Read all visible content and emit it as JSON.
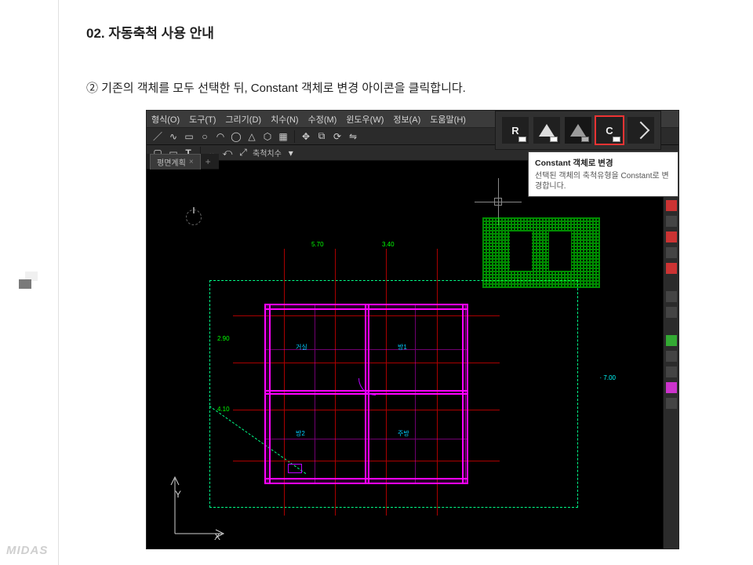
{
  "heading": "02. 자동축척 사용 안내",
  "body_line": "② 기존의 객체를 모두 선택한 뒤, Constant 객체로 변경 아이콘을 클릭합니다.",
  "midas_logo": "MIDAS",
  "menu": {
    "format": "형식(O)",
    "tool": "도구(T)",
    "draw": "그리기(D)",
    "dim": "치수(N)",
    "modify": "수정(M)",
    "window": "윈도우(W)",
    "info": "정보(A)",
    "help": "도움말(H)"
  },
  "toolbar2": {
    "label_scale": "축척치수"
  },
  "iconstrip": {
    "r": "R",
    "c": "C"
  },
  "tooltip": {
    "title": "Constant 객체로 변경",
    "body": "선택된 객체의 축척유형을 Constant로 변경합니다."
  },
  "tab": {
    "name": "평면계획",
    "close": "×",
    "plus": "+"
  },
  "axes": {
    "y": "Y",
    "x": "X"
  },
  "coord": "· 7.00",
  "rooms": {
    "r1": "거실",
    "r2": "방1",
    "r3": "방2",
    "r4": "주방"
  },
  "dims": {
    "d1": "5.70",
    "d2": "3.40",
    "d3": "2.90",
    "d4": "4.10"
  }
}
